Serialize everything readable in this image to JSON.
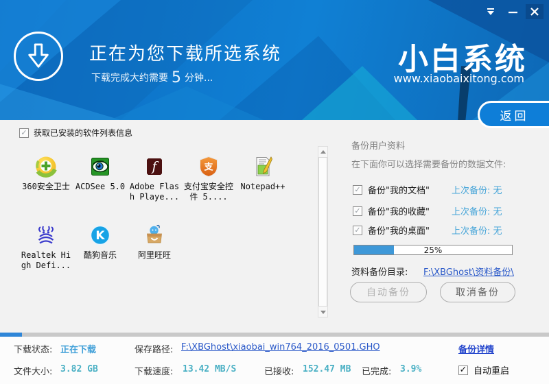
{
  "icons": {
    "check": "✓"
  },
  "header": {
    "title": "正在为您下载所选系统",
    "subtitle_prefix": "下载完成大约需要",
    "subtitle_number": "5",
    "subtitle_suffix": "分钟...",
    "logo": "小白系统",
    "website": "www.xiaobaixitong.com",
    "back_label": "返回"
  },
  "software": {
    "select_all_label": "获取已安装的软件列表信息",
    "items": [
      {
        "label": "360安全卫士",
        "icon": "360-safe-icon"
      },
      {
        "label": "ACDSee 5.0",
        "icon": "acdsee-icon"
      },
      {
        "label": "Adobe Flash Playe...",
        "icon": "flash-icon"
      },
      {
        "label": "支付宝安全控件 5....",
        "icon": "alipay-icon"
      },
      {
        "label": "Notepad++",
        "icon": "notepad-icon"
      },
      {
        "label": "Realtek High Defi...",
        "icon": "realtek-icon"
      },
      {
        "label": "酷狗音乐",
        "icon": "kugou-icon"
      },
      {
        "label": "阿里旺旺",
        "icon": "aliwangwang-icon"
      }
    ]
  },
  "backup": {
    "title": "备份用户资料",
    "description": "在下面你可以选择需要备份的数据文件:",
    "items": [
      {
        "label": "备份\"我的文档\"",
        "last_backup": "上次备份: 无"
      },
      {
        "label": "备份\"我的收藏\"",
        "last_backup": "上次备份: 无"
      },
      {
        "label": "备份\"我的桌面\"",
        "last_backup": "上次备份: 无"
      }
    ],
    "progress_label": "25%",
    "progress_percent": 25,
    "dir_label": "资料备份目录:",
    "dir_link": "F:\\XBGhost\\资料备份\\",
    "auto_button": "自动备份",
    "cancel_button": "取消备份"
  },
  "status": {
    "download_state_label": "下载状态:",
    "download_state": "正在下载",
    "save_path_label": "保存路径:",
    "save_path": "F:\\XBGhost\\xiaobai_win764_2016_0501.GHO",
    "backup_detail_link": "备份详情",
    "file_size_label": "文件大小:",
    "file_size": "3.82 GB",
    "speed_label": "下载速度:",
    "speed": "13.42 MB/S",
    "received_label": "已接收:",
    "received": "152.47 MB",
    "completed_label": "已完成:",
    "completed": "3.9%",
    "auto_restart_label": "自动重启",
    "thin_progress_percent": 4
  },
  "colors": {
    "header_blue": "#0e76cc",
    "accent_blue": "#2f86d8",
    "value_teal": "#4ab0c4",
    "link_blue": "#2857c8",
    "light_blue": "#3f9fd8"
  }
}
